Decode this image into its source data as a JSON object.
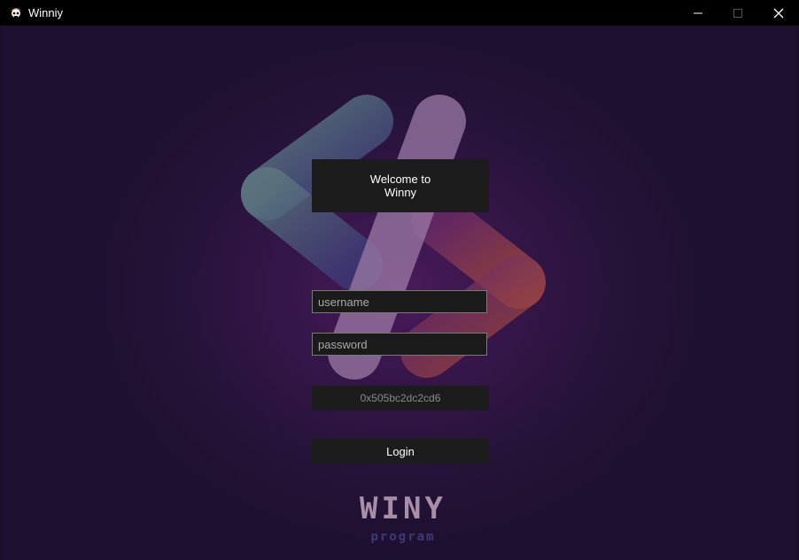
{
  "window": {
    "title": "Winniy",
    "icon": "pirate-skull-icon",
    "controls": {
      "minimize": "minimize-icon",
      "maximize": "maximize-icon",
      "close": "close-icon"
    }
  },
  "login": {
    "welcome_line1": "Welcome to",
    "welcome_line2": "Winny",
    "username_placeholder": "username",
    "password_placeholder": "password",
    "hwid": "0x505bc2dc2cd6",
    "login_label": "Login"
  },
  "branding": {
    "title": "WINY",
    "subtitle": "program"
  },
  "colors": {
    "background": "#1a0f26",
    "panel": "#1c1c1c",
    "accent_purple": "#4a1a5a"
  }
}
